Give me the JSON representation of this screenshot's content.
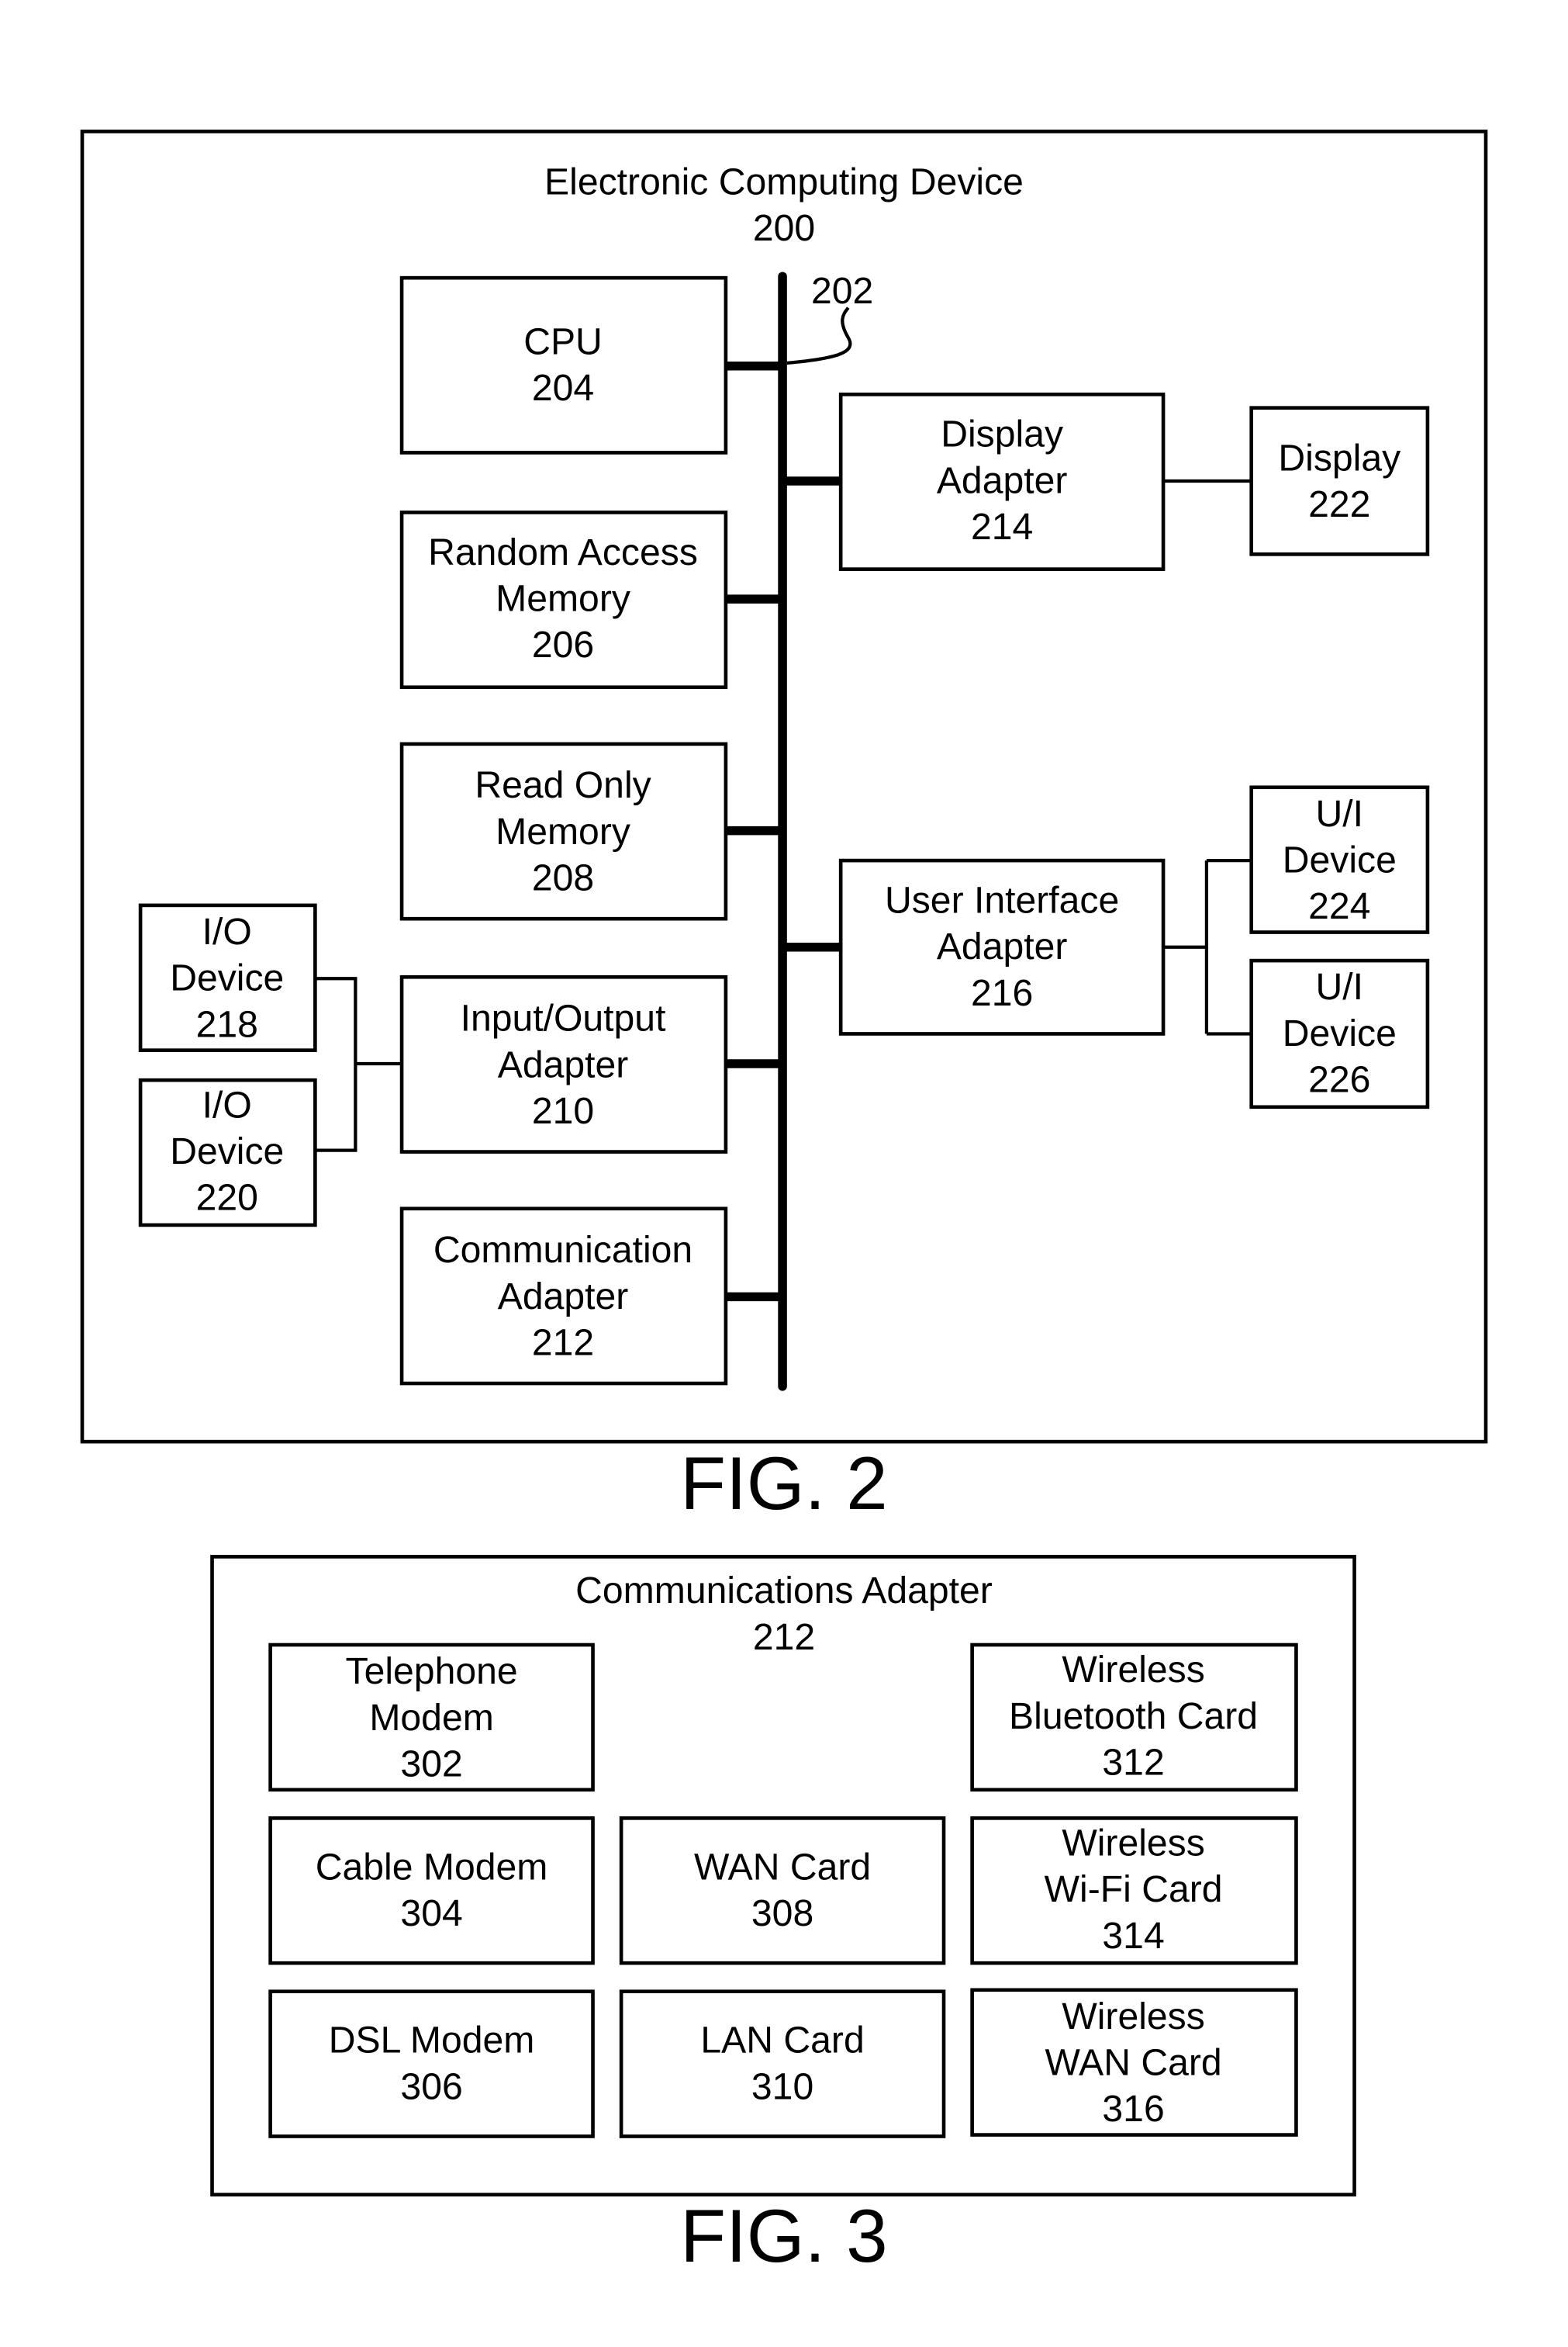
{
  "fig2": {
    "title": "Electronic Computing Device",
    "ref": "200",
    "bus_ref": "202",
    "caption": "FIG. 2",
    "components": {
      "cpu": [
        "CPU",
        "204"
      ],
      "ram": [
        "Random Access",
        "Memory",
        "206"
      ],
      "rom": [
        "Read Only",
        "Memory",
        "208"
      ],
      "io_adapter": [
        "Input/Output",
        "Adapter",
        "210"
      ],
      "comm_adapter": [
        "Communication",
        "Adapter",
        "212"
      ],
      "display_adapter": [
        "Display",
        "Adapter",
        "214"
      ],
      "ui_adapter": [
        "User Interface",
        "Adapter",
        "216"
      ],
      "io_device_218": [
        "I/O",
        "Device",
        "218"
      ],
      "io_device_220": [
        "I/O",
        "Device",
        "220"
      ],
      "display": [
        "Display",
        "222"
      ],
      "ui_device_224": [
        "U/I",
        "Device",
        "224"
      ],
      "ui_device_226": [
        "U/I",
        "Device",
        "226"
      ]
    }
  },
  "fig3": {
    "title": "Communications Adapter",
    "ref": "212",
    "caption": "FIG. 3",
    "components": {
      "telephone_modem": [
        "Telephone",
        "Modem",
        "302"
      ],
      "cable_modem": [
        "Cable Modem",
        "304"
      ],
      "dsl_modem": [
        "DSL Modem",
        "306"
      ],
      "wan_card": [
        "WAN Card",
        "308"
      ],
      "lan_card": [
        "LAN Card",
        "310"
      ],
      "bluetooth_card": [
        "Wireless",
        "Bluetooth Card",
        "312"
      ],
      "wifi_card": [
        "Wireless",
        "Wi-Fi Card",
        "314"
      ],
      "wireless_wan_card": [
        "Wireless",
        "WAN Card",
        "316"
      ]
    }
  }
}
